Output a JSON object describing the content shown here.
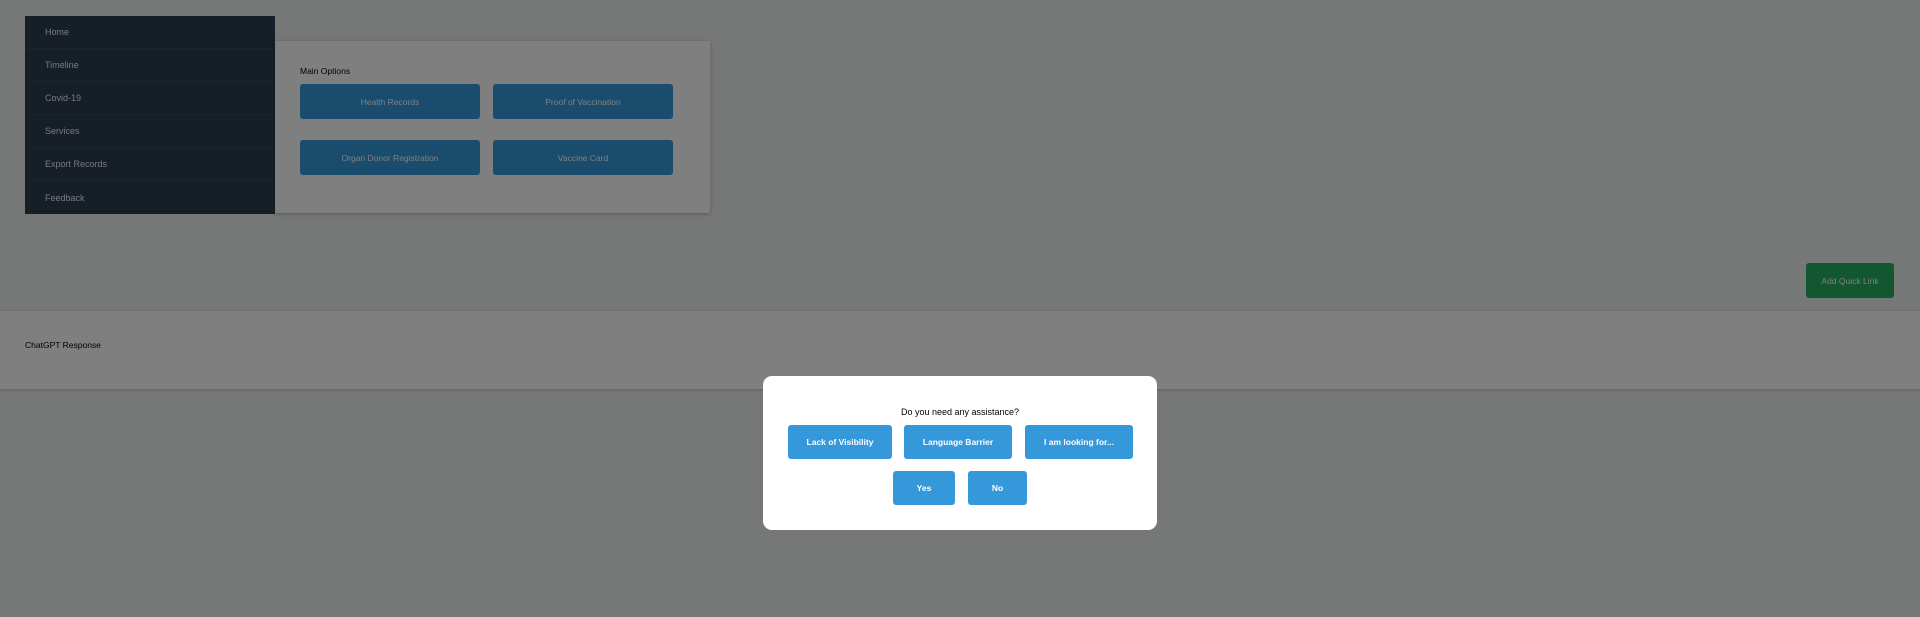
{
  "sidebar": {
    "items": [
      {
        "label": "Home"
      },
      {
        "label": "Timeline"
      },
      {
        "label": "Covid-19"
      },
      {
        "label": "Services"
      },
      {
        "label": "Export Records"
      },
      {
        "label": "Feedback"
      }
    ]
  },
  "main": {
    "title": "Main Options",
    "buttons": [
      {
        "label": "Health Records"
      },
      {
        "label": "Proof of Vaccination"
      },
      {
        "label": "Organ Donor Registration"
      },
      {
        "label": "Vaccine Card"
      }
    ]
  },
  "quick_link": {
    "label": "Add Quick Link"
  },
  "response": {
    "label": "ChatGPT Response"
  },
  "modal": {
    "question": "Do you need any assistance?",
    "options": [
      {
        "label": "Lack of Visibility"
      },
      {
        "label": "Language Barrier"
      },
      {
        "label": "I am looking for..."
      }
    ],
    "yes_label": "Yes",
    "no_label": "No"
  },
  "colors": {
    "sidebar_bg": "#2c3e50",
    "primary": "#3498db",
    "success": "#27ae60",
    "page_bg": "#ecf0f1"
  }
}
